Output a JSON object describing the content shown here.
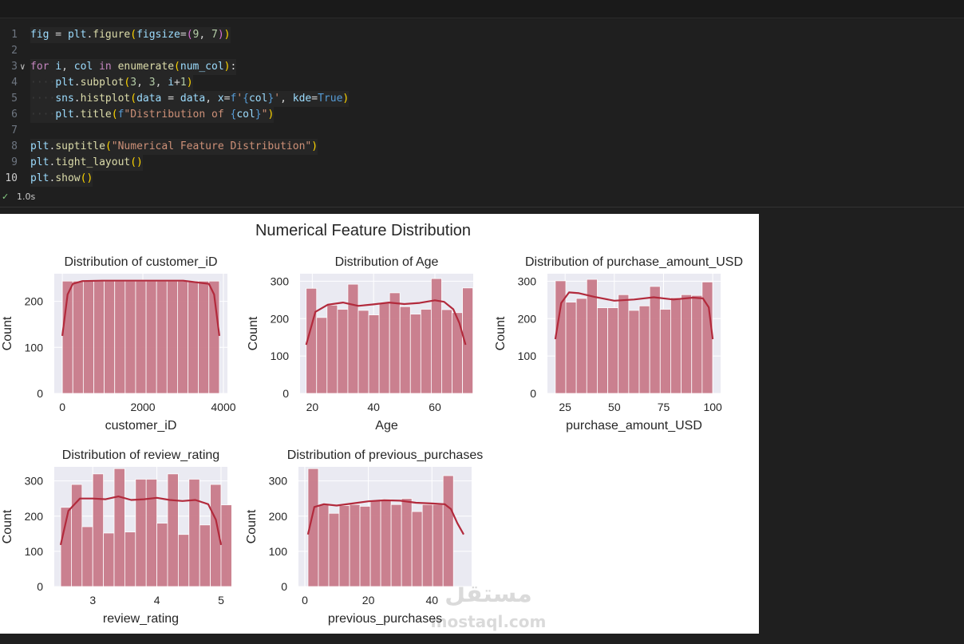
{
  "code_lines": [
    {
      "num": "1",
      "tokens": [
        [
          "v",
          "fig"
        ],
        [
          "o",
          " = "
        ],
        [
          "v",
          "plt"
        ],
        [
          "o",
          "."
        ],
        [
          "f",
          "figure"
        ],
        [
          "b",
          "("
        ],
        [
          "v",
          "figsize"
        ],
        [
          "o",
          "="
        ],
        [
          "b2",
          "("
        ],
        [
          "n",
          "9"
        ],
        [
          "o",
          ", "
        ],
        [
          "n",
          "7"
        ],
        [
          "b2",
          ")"
        ],
        [
          "b",
          ")"
        ]
      ]
    },
    {
      "num": "2",
      "tokens": []
    },
    {
      "num": "3",
      "fold": true,
      "tokens": [
        [
          "k",
          "for"
        ],
        [
          "o",
          " "
        ],
        [
          "v",
          "i"
        ],
        [
          "o",
          ", "
        ],
        [
          "v",
          "col"
        ],
        [
          "o",
          " "
        ],
        [
          "k",
          "in"
        ],
        [
          "o",
          " "
        ],
        [
          "f",
          "enumerate"
        ],
        [
          "b",
          "("
        ],
        [
          "v",
          "num_col"
        ],
        [
          "b",
          ")"
        ],
        [
          "o",
          ":"
        ]
      ]
    },
    {
      "num": "4",
      "tokens": [
        [
          "ws",
          "····"
        ],
        [
          "v",
          "plt"
        ],
        [
          "o",
          "."
        ],
        [
          "f",
          "subplot"
        ],
        [
          "b",
          "("
        ],
        [
          "n",
          "3"
        ],
        [
          "o",
          ", "
        ],
        [
          "n",
          "3"
        ],
        [
          "o",
          ", "
        ],
        [
          "v",
          "i"
        ],
        [
          "o",
          "+"
        ],
        [
          "n",
          "1"
        ],
        [
          "b",
          ")"
        ]
      ]
    },
    {
      "num": "5",
      "tokens": [
        [
          "ws",
          "····"
        ],
        [
          "v",
          "sns"
        ],
        [
          "o",
          "."
        ],
        [
          "f",
          "histplot"
        ],
        [
          "b",
          "("
        ],
        [
          "v",
          "data"
        ],
        [
          "o",
          " = "
        ],
        [
          "v",
          "data"
        ],
        [
          "o",
          ", "
        ],
        [
          "v",
          "x"
        ],
        [
          "o",
          "="
        ],
        [
          "c",
          "f"
        ],
        [
          "s",
          "'"
        ],
        [
          "c",
          "{"
        ],
        [
          "v",
          "col"
        ],
        [
          "c",
          "}"
        ],
        [
          "s",
          "'"
        ],
        [
          "o",
          ", "
        ],
        [
          "v",
          "kde"
        ],
        [
          "o",
          "="
        ],
        [
          "c",
          "True"
        ],
        [
          "b",
          ")"
        ]
      ]
    },
    {
      "num": "6",
      "tokens": [
        [
          "ws",
          "····"
        ],
        [
          "v",
          "plt"
        ],
        [
          "o",
          "."
        ],
        [
          "f",
          "title"
        ],
        [
          "b",
          "("
        ],
        [
          "c",
          "f"
        ],
        [
          "s",
          "\"Distribution of "
        ],
        [
          "c",
          "{"
        ],
        [
          "v",
          "col"
        ],
        [
          "c",
          "}"
        ],
        [
          "s",
          "\""
        ],
        [
          "b",
          ")"
        ]
      ]
    },
    {
      "num": "7",
      "tokens": []
    },
    {
      "num": "8",
      "tokens": [
        [
          "v",
          "plt"
        ],
        [
          "o",
          "."
        ],
        [
          "f",
          "suptitle"
        ],
        [
          "b",
          "("
        ],
        [
          "s",
          "\"Numerical Feature Distribution\""
        ],
        [
          "b",
          ")"
        ]
      ]
    },
    {
      "num": "9",
      "tokens": [
        [
          "v",
          "plt"
        ],
        [
          "o",
          "."
        ],
        [
          "f",
          "tight_layout"
        ],
        [
          "b",
          "()"
        ]
      ]
    },
    {
      "num": "10",
      "current": true,
      "tokens": [
        [
          "v",
          "plt"
        ],
        [
          "o",
          "."
        ],
        [
          "f",
          "show"
        ],
        [
          "b",
          "()"
        ]
      ]
    }
  ],
  "status": {
    "check": "✓",
    "time": "1.0s"
  },
  "colors": {
    "bar": "#c97b8a",
    "kde": "#b22a3c",
    "plot_bg": "#eaeaf2",
    "grid": "#ffffff"
  },
  "figure": {
    "suptitle": "Numerical Feature Distribution"
  },
  "chart_data": [
    {
      "type": "bar",
      "title": "Distribution of customer_iD",
      "xlabel": "customer_iD",
      "ylabel": "Count",
      "xlim": [
        -200,
        4100
      ],
      "ylim": [
        0,
        260
      ],
      "xticks": [
        0,
        2000,
        4000
      ],
      "yticks": [
        0,
        100,
        200
      ],
      "bin_start": 1,
      "bin_width": 259.9,
      "values": [
        244,
        244,
        244,
        244,
        244,
        244,
        244,
        244,
        244,
        244,
        244,
        244,
        244,
        244,
        244
      ],
      "kde": [
        [
          1,
          125
        ],
        [
          130,
          215
        ],
        [
          259,
          238
        ],
        [
          500,
          244
        ],
        [
          1000,
          245
        ],
        [
          2000,
          245
        ],
        [
          3000,
          245
        ],
        [
          3640,
          238
        ],
        [
          3770,
          215
        ],
        [
          3900,
          125
        ]
      ]
    },
    {
      "type": "bar",
      "title": "Distribution of Age",
      "xlabel": "Age",
      "ylabel": "Count",
      "xlim": [
        16,
        72.5
      ],
      "ylim": [
        0,
        320
      ],
      "xticks": [
        20,
        40,
        60
      ],
      "yticks": [
        0,
        100,
        200,
        300
      ],
      "bin_start": 18,
      "bin_width": 3.4,
      "values": [
        281,
        203,
        236,
        225,
        292,
        222,
        210,
        243,
        269,
        232,
        212,
        225,
        307,
        224,
        216,
        282
      ],
      "kde": [
        [
          18,
          130
        ],
        [
          21,
          218
        ],
        [
          25,
          237
        ],
        [
          30,
          243
        ],
        [
          35,
          234
        ],
        [
          40,
          238
        ],
        [
          45,
          243
        ],
        [
          50,
          239
        ],
        [
          55,
          242
        ],
        [
          60,
          249
        ],
        [
          63,
          245
        ],
        [
          66,
          225
        ],
        [
          68,
          188
        ],
        [
          70,
          130
        ]
      ]
    },
    {
      "type": "bar",
      "title": "Distribution of purchase_amount_USD",
      "xlabel": "purchase_amount_USD",
      "ylabel": "Count",
      "xlim": [
        16,
        104
      ],
      "ylim": [
        0,
        320
      ],
      "xticks": [
        25,
        50,
        75,
        100
      ],
      "yticks": [
        0,
        100,
        200,
        300
      ],
      "bin_start": 20,
      "bin_width": 5.33,
      "values": [
        301,
        244,
        254,
        305,
        229,
        229,
        264,
        222,
        234,
        286,
        225,
        256,
        264,
        262,
        298
      ],
      "kde": [
        [
          20,
          145
        ],
        [
          23,
          242
        ],
        [
          27,
          270
        ],
        [
          32,
          268
        ],
        [
          40,
          258
        ],
        [
          50,
          248
        ],
        [
          60,
          251
        ],
        [
          70,
          257
        ],
        [
          80,
          251
        ],
        [
          90,
          256
        ],
        [
          95,
          254
        ],
        [
          98,
          230
        ],
        [
          100,
          145
        ]
      ]
    },
    {
      "type": "bar",
      "title": "Distribution of review_rating",
      "xlabel": "review_rating",
      "ylabel": "Count",
      "xlim": [
        2.4,
        5.1
      ],
      "ylim": [
        0,
        340
      ],
      "xticks": [
        3,
        4,
        5
      ],
      "yticks": [
        0,
        100,
        200,
        300
      ],
      "bin_start": 2.5,
      "bin_width": 0.16667,
      "values": [
        225,
        290,
        170,
        320,
        152,
        335,
        155,
        305,
        305,
        180,
        320,
        148,
        305,
        175,
        290,
        232
      ],
      "kde": [
        [
          2.5,
          118
        ],
        [
          2.62,
          215
        ],
        [
          2.8,
          250
        ],
        [
          3.0,
          250
        ],
        [
          3.2,
          248
        ],
        [
          3.4,
          256
        ],
        [
          3.6,
          246
        ],
        [
          3.8,
          248
        ],
        [
          4.0,
          252
        ],
        [
          4.2,
          246
        ],
        [
          4.4,
          243
        ],
        [
          4.6,
          246
        ],
        [
          4.8,
          234
        ],
        [
          4.92,
          190
        ],
        [
          5.0,
          118
        ]
      ]
    },
    {
      "type": "bar",
      "title": "Distribution of previous_purchases",
      "xlabel": "previous_purchases",
      "ylabel": "Count",
      "xlim": [
        -2,
        52.5
      ],
      "ylim": [
        0,
        340
      ],
      "xticks": [
        0,
        20,
        40
      ],
      "yticks": [
        0,
        100,
        200,
        300
      ],
      "bin_start": 1,
      "bin_width": 3.27,
      "values": [
        335,
        232,
        208,
        230,
        233,
        228,
        244,
        248,
        233,
        250,
        213,
        233,
        233,
        315
      ],
      "kde": [
        [
          1,
          148
        ],
        [
          3,
          226
        ],
        [
          6,
          234
        ],
        [
          10,
          230
        ],
        [
          15,
          236
        ],
        [
          20,
          242
        ],
        [
          25,
          245
        ],
        [
          30,
          244
        ],
        [
          35,
          238
        ],
        [
          40,
          236
        ],
        [
          44,
          234
        ],
        [
          46,
          220
        ],
        [
          48,
          180
        ],
        [
          50,
          148
        ]
      ]
    }
  ]
}
